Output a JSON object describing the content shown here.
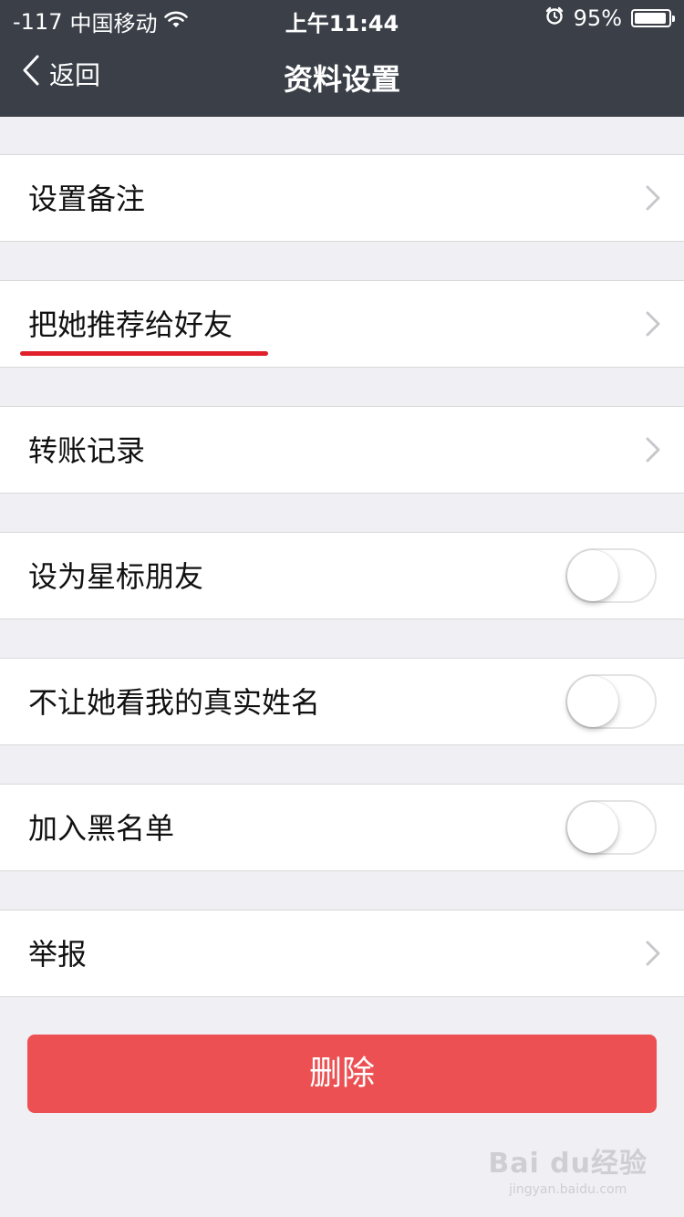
{
  "status_bar": {
    "signal": "-117",
    "carrier": "中国移动",
    "time": "上午11:44",
    "battery_percent": "95%",
    "battery_level": 0.95
  },
  "navbar": {
    "back_label": "返回",
    "title": "资料设置"
  },
  "rows": [
    {
      "label": "设置备注",
      "type": "link"
    },
    {
      "label": "把她推荐给好友",
      "type": "link"
    },
    {
      "label": "转账记录",
      "type": "link"
    },
    {
      "label": "设为星标朋友",
      "type": "toggle",
      "on": false
    },
    {
      "label": "不让她看我的真实姓名",
      "type": "toggle",
      "on": false
    },
    {
      "label": "加入黑名单",
      "type": "toggle",
      "on": false
    },
    {
      "label": "举报",
      "type": "link"
    }
  ],
  "delete_button": {
    "label": "删除"
  },
  "watermark": {
    "logo": "Bai du经验",
    "sub": "jingyan.baidu.com"
  },
  "colors": {
    "navbar_bg": "#3a3f48",
    "delete_bg": "#ec5052",
    "highlight_underline": "#e0202a",
    "page_bg": "#efeff4"
  }
}
